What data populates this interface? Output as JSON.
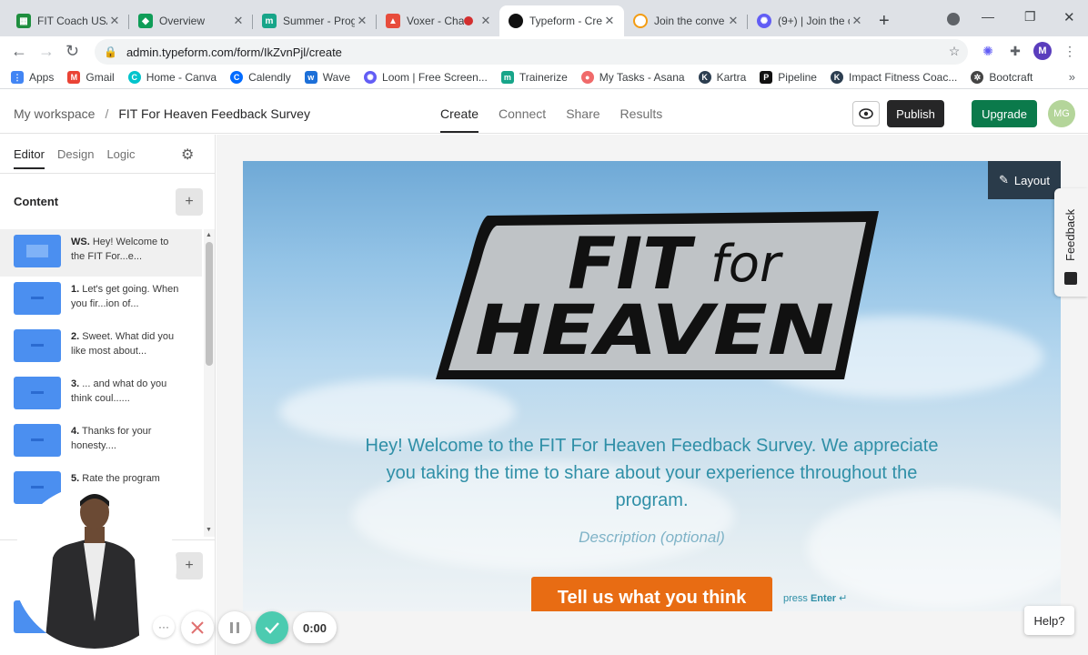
{
  "browser": {
    "tabs": [
      {
        "label": "FIT Coach USA",
        "icon": "green-sheet-icon",
        "color": "#1e8e3e"
      },
      {
        "label": "Overview",
        "icon": "green-app-icon",
        "color": "#0f9d58"
      },
      {
        "label": "Summer - Prog",
        "icon": "trainerize-icon",
        "color": "#17a589"
      },
      {
        "label": "Voxer - Cha",
        "icon": "voxer-icon",
        "color": "#e74c3c"
      },
      {
        "label": "Typeform - Cre",
        "icon": "typeform-icon",
        "color": "#111111",
        "active": true
      },
      {
        "label": "Join the conve",
        "icon": "orange-icon",
        "color": "#f39c12"
      },
      {
        "label": "(9+) | Join the c",
        "icon": "loom-icon",
        "color": "#625df5"
      }
    ],
    "url": "admin.typeform.com/form/IkZvnPjl/create",
    "profile_initial": "M",
    "bookmarks": [
      {
        "label": "Apps",
        "icon": "apps-grid-icon",
        "color": "#4285f4"
      },
      {
        "label": "Gmail",
        "icon": "gmail-icon",
        "color": "#ea4335"
      },
      {
        "label": "Home - Canva",
        "icon": "canva-icon",
        "color": "#00c4cc"
      },
      {
        "label": "Calendly",
        "icon": "calendly-icon",
        "color": "#006bff"
      },
      {
        "label": "Wave",
        "icon": "wave-icon",
        "color": "#1c6fd8"
      },
      {
        "label": "Loom | Free Screen...",
        "icon": "loom-icon",
        "color": "#625df5"
      },
      {
        "label": "Trainerize",
        "icon": "trainerize-icon",
        "color": "#17a589"
      },
      {
        "label": "My Tasks - Asana",
        "icon": "asana-icon",
        "color": "#f06a6a"
      },
      {
        "label": "Kartra",
        "icon": "kartra-icon",
        "color": "#2c3e50"
      },
      {
        "label": "Pipeline",
        "icon": "pipeline-icon",
        "color": "#111111"
      },
      {
        "label": "Impact Fitness Coac...",
        "icon": "kartra-icon",
        "color": "#2c3e50"
      },
      {
        "label": "Bootcraft",
        "icon": "bootcraft-icon",
        "color": "#444444"
      }
    ]
  },
  "header": {
    "workspace": "My workspace",
    "separator": "/",
    "form_name": "FIT For Heaven Feedback Survey",
    "tabs": [
      "Create",
      "Connect",
      "Share",
      "Results"
    ],
    "publish": "Publish",
    "upgrade": "Upgrade",
    "user_initials": "MG",
    "accent": "#0b7a4b"
  },
  "left": {
    "tabs": [
      "Editor",
      "Design",
      "Logic"
    ],
    "content_title": "Content",
    "questions": [
      {
        "num": "WS.",
        "text": "Hey! Welcome to the FIT For...e..."
      },
      {
        "num": "1.",
        "text": "Let's get going. When you fir...ion of..."
      },
      {
        "num": "2.",
        "text": "Sweet. What did you like most about..."
      },
      {
        "num": "3.",
        "text": "... and what do you think coul......"
      },
      {
        "num": "4.",
        "text": "Thanks for your honesty...."
      },
      {
        "num": "5.",
        "text": "Rate the program ...fficulty"
      }
    ]
  },
  "slide": {
    "layout_label": "Layout",
    "logo_line1": "FIT",
    "logo_for": "for",
    "logo_line2": "HEAVEN",
    "welcome": "Hey! Welcome to the FIT For Heaven Feedback Survey. We appreciate you taking the time to share about your experience throughout the program.",
    "description": "Description (optional)",
    "cta": "Tell us what you think",
    "press_prefix": "press",
    "press_key": "Enter",
    "cta_color": "#e86c13",
    "text_color": "#2f8fa7"
  },
  "side": {
    "feedback": "Feedback",
    "help": "Help?"
  },
  "recorder": {
    "timer": "0:00"
  }
}
